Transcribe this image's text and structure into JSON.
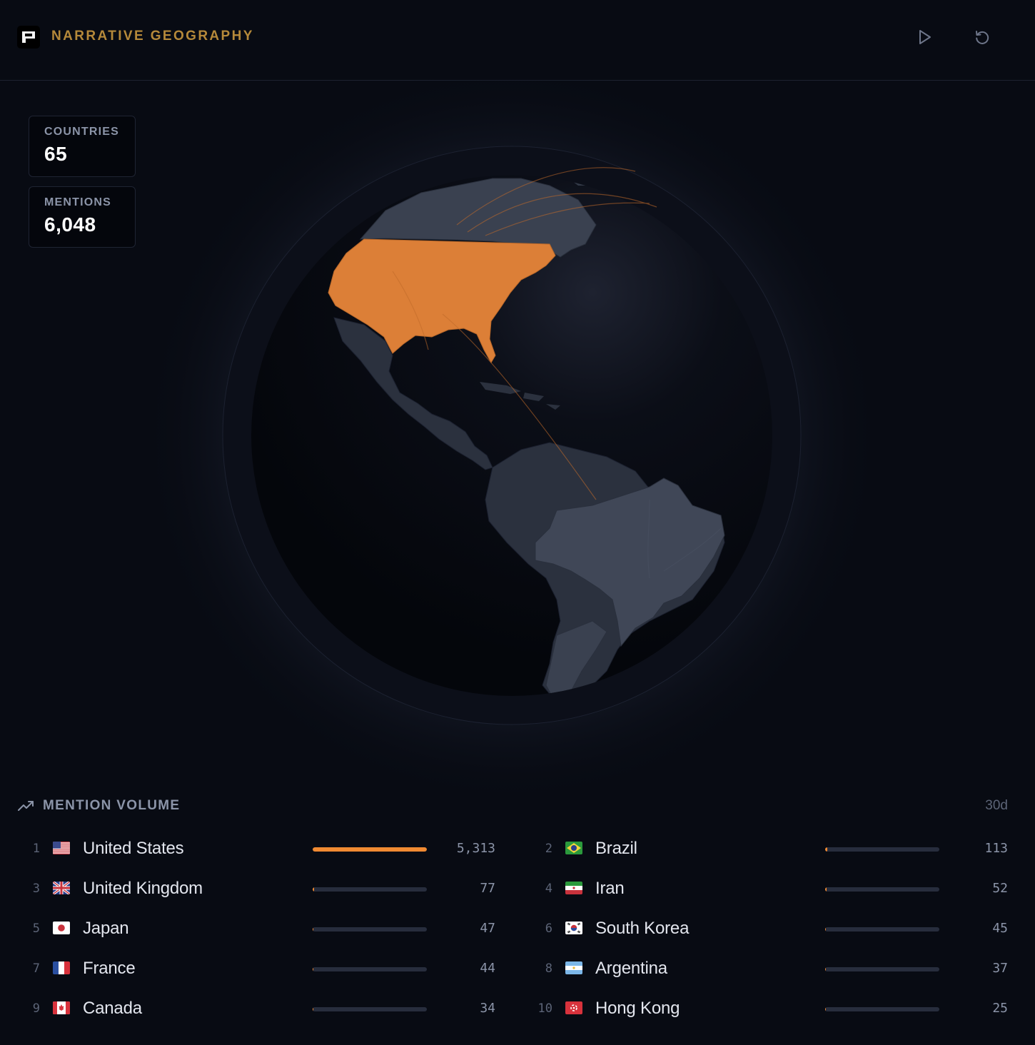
{
  "header": {
    "title": "NARRATIVE GEOGRAPHY",
    "logo_icon": "logo-icon",
    "play_icon": "play-icon",
    "reset_icon": "reset-icon"
  },
  "stats": {
    "countries_label": "COUNTRIES",
    "countries_value": "65",
    "mentions_label": "MENTIONS",
    "mentions_value": "6,048"
  },
  "globe": {
    "highlight_color": "#dc7f37",
    "land_color": "#3a4150",
    "ocean_color": "#05070d",
    "highlighted_country": "United States"
  },
  "volume": {
    "title": "MENTION VOLUME",
    "period": "30d",
    "icon": "trending-up-icon",
    "accent": "#f08a32",
    "items": [
      {
        "rank": "1",
        "country": "United States",
        "count": "5,313",
        "share": 1.0,
        "flag": "us"
      },
      {
        "rank": "2",
        "country": "Brazil",
        "count": "113",
        "share": 0.021,
        "flag": "br"
      },
      {
        "rank": "3",
        "country": "United Kingdom",
        "count": "77",
        "share": 0.014,
        "flag": "gb"
      },
      {
        "rank": "4",
        "country": "Iran",
        "count": "52",
        "share": 0.0098,
        "flag": "ir"
      },
      {
        "rank": "5",
        "country": "Japan",
        "count": "47",
        "share": 0.0088,
        "flag": "jp"
      },
      {
        "rank": "6",
        "country": "South Korea",
        "count": "45",
        "share": 0.0085,
        "flag": "kr"
      },
      {
        "rank": "7",
        "country": "France",
        "count": "44",
        "share": 0.0083,
        "flag": "fr"
      },
      {
        "rank": "8",
        "country": "Argentina",
        "count": "37",
        "share": 0.007,
        "flag": "ar"
      },
      {
        "rank": "9",
        "country": "Canada",
        "count": "34",
        "share": 0.0064,
        "flag": "ca"
      },
      {
        "rank": "10",
        "country": "Hong Kong",
        "count": "25",
        "share": 0.0047,
        "flag": "hk"
      }
    ]
  }
}
